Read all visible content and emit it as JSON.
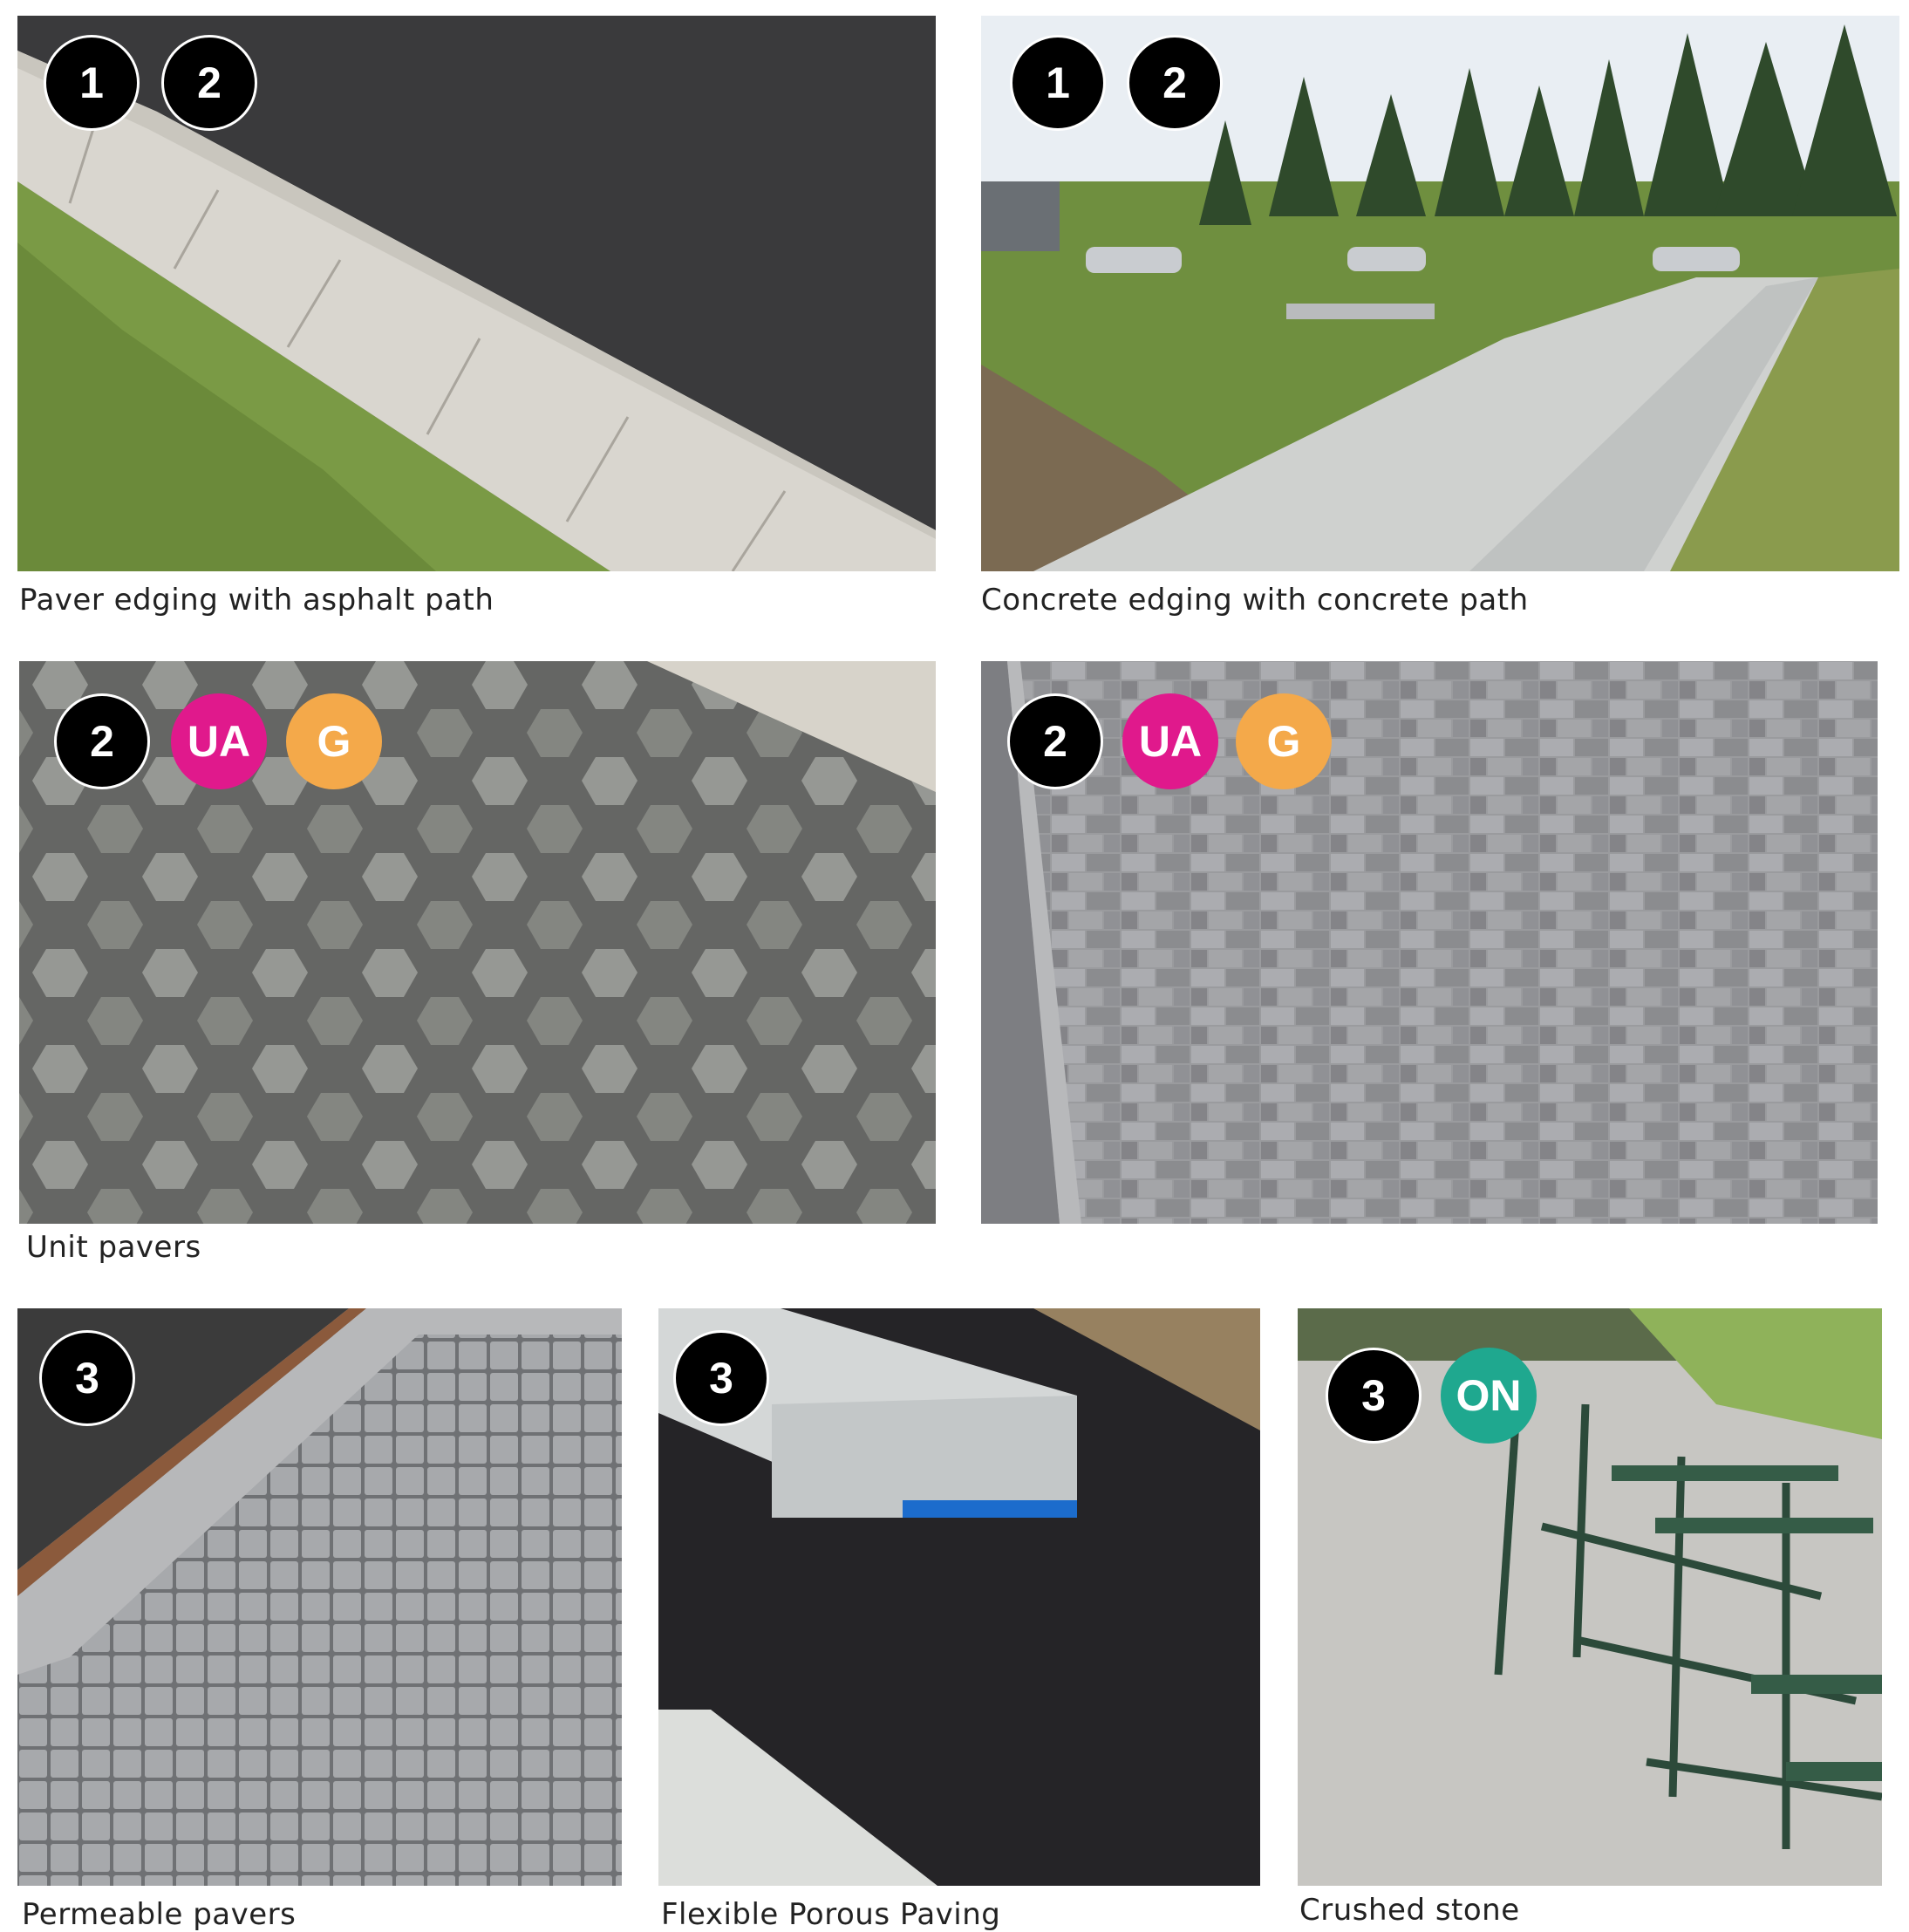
{
  "panels": [
    {
      "caption": "Paver edging with asphalt path",
      "badges": [
        "1",
        "2"
      ]
    },
    {
      "caption": "Concrete edging with concrete path",
      "badges": [
        "1",
        "2"
      ]
    },
    {
      "badges": [
        "2",
        "UA",
        "G"
      ]
    },
    {
      "badges": [
        "2",
        "UA",
        "G"
      ]
    },
    {
      "caption": "Permeable pavers",
      "badges": [
        "3"
      ]
    },
    {
      "caption": "Flexible Porous Paving",
      "badges": [
        "3"
      ]
    },
    {
      "caption": "Crushed stone",
      "badges": [
        "3",
        "ON"
      ]
    }
  ],
  "group_caption": "Unit pavers",
  "colors": {
    "UA": "#e0198c",
    "G": "#f4a94a",
    "ON": "#1fa88f",
    "number": "#000000"
  }
}
